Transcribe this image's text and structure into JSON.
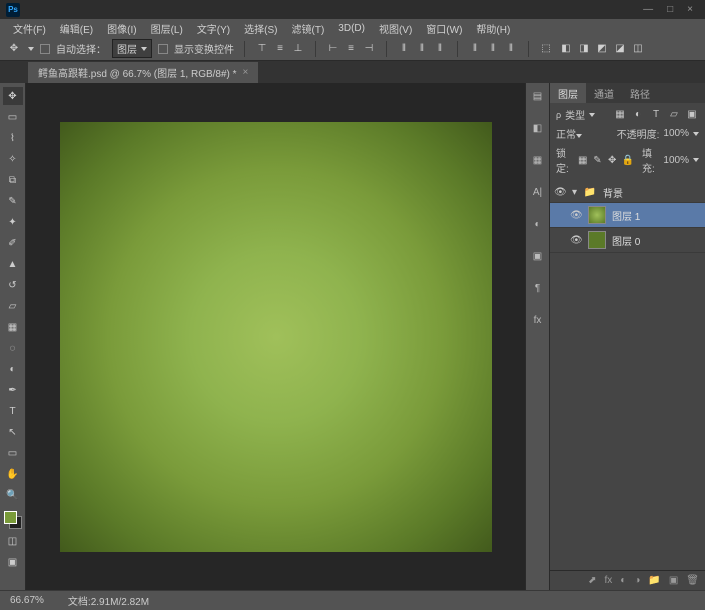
{
  "app": {
    "logo_text": "Ps"
  },
  "window_controls": {
    "minimize": "—",
    "maximize": "□",
    "close": "×"
  },
  "menu": [
    "文件(F)",
    "编辑(E)",
    "图像(I)",
    "图层(L)",
    "文字(Y)",
    "选择(S)",
    "滤镜(T)",
    "3D(D)",
    "视图(V)",
    "窗口(W)",
    "帮助(H)"
  ],
  "options": {
    "auto_select_label": "自动选择：",
    "auto_select_target": "图层",
    "show_transform_label": "显示变换控件"
  },
  "document": {
    "tab_title": "鳄鱼高跟鞋.psd @ 66.7% (图层 1, RGB/8#) *",
    "zoom": "66.67%",
    "doc_size": "文档:2.91M/2.82M"
  },
  "layers_panel": {
    "tabs": [
      "图层",
      "通道",
      "路径"
    ],
    "filter_label": "类型",
    "blend_mode": "正常",
    "opacity_label": "不透明度:",
    "opacity_value": "100%",
    "lock_label": "锁定:",
    "fill_label": "填充:",
    "fill_value": "100%",
    "group_name": "背景",
    "layer1_name": "图层 1",
    "layer0_name": "图层 0"
  },
  "colors": {
    "canvas_center": "#a0c05a",
    "canvas_edge": "#425a1c",
    "foreground_swatch": "#7a9b3a"
  }
}
